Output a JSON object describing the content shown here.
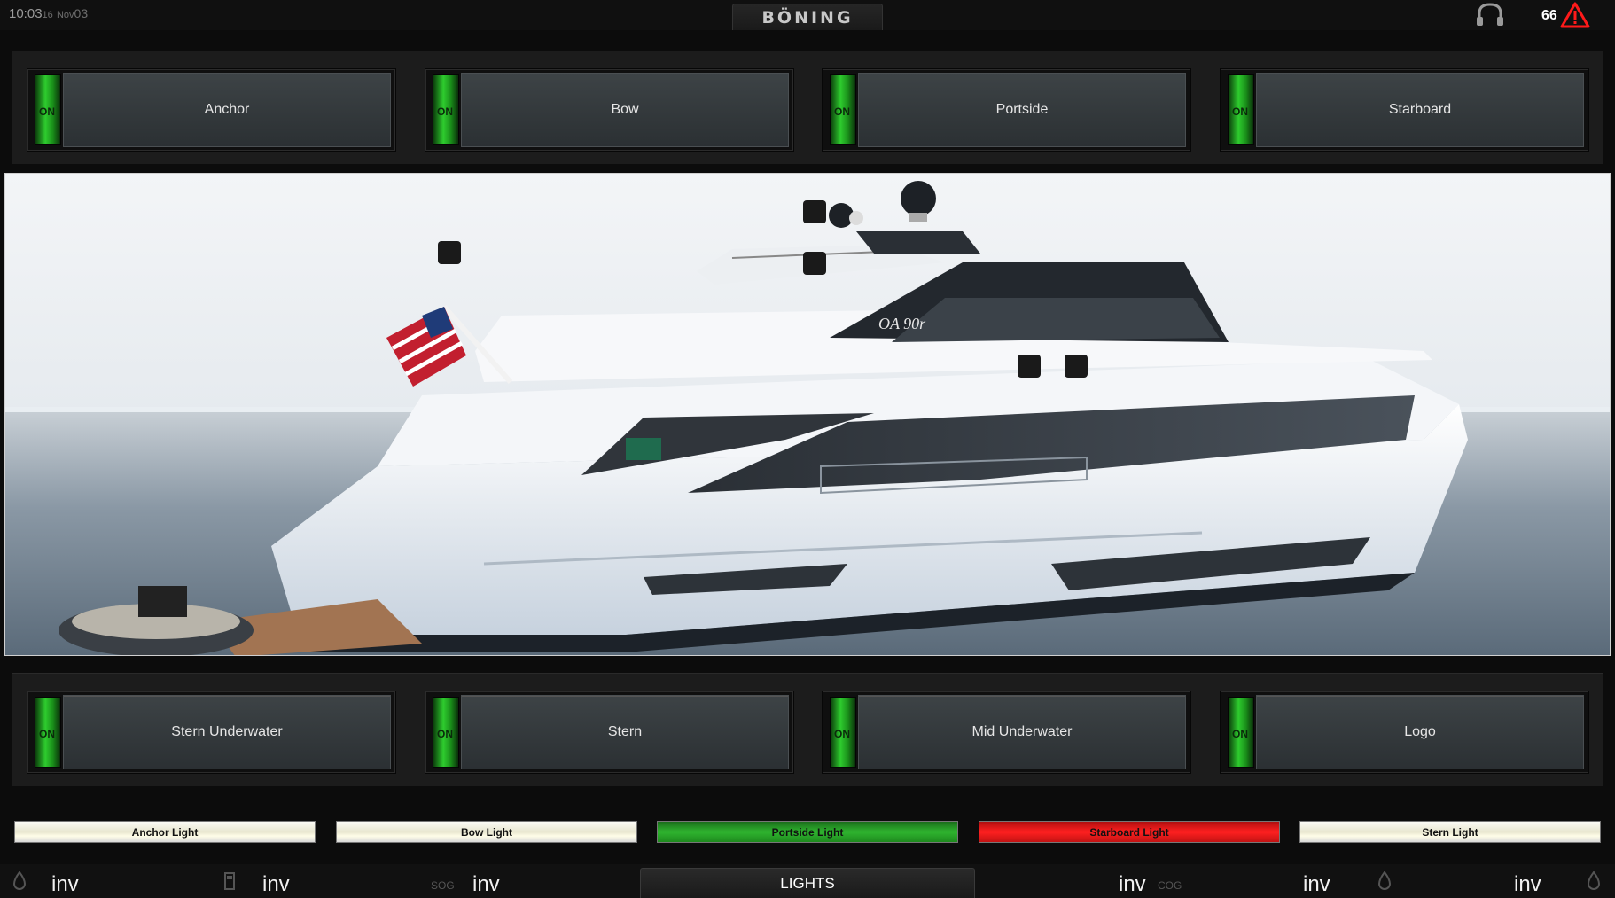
{
  "topbar": {
    "time_hm": "10:03",
    "time_sec": "16",
    "date_month": "Nov",
    "date_day": "03",
    "brand": "BÖNING",
    "alarm_count": "66",
    "icons": [
      "headset-icon",
      "warning-icon"
    ]
  },
  "top_switches": [
    {
      "label": "Anchor",
      "state": "ON"
    },
    {
      "label": "Bow",
      "state": "ON"
    },
    {
      "label": "Portside",
      "state": "ON"
    },
    {
      "label": "Starboard",
      "state": "ON"
    }
  ],
  "bottom_switches": [
    {
      "label": "Stern Underwater",
      "state": "ON"
    },
    {
      "label": "Stern",
      "state": "ON"
    },
    {
      "label": "Mid Underwater",
      "state": "ON"
    },
    {
      "label": "Logo",
      "state": "ON"
    }
  ],
  "yacht": {
    "model_text": "OA 90r"
  },
  "indicators": [
    {
      "label": "Anchor Light",
      "color": "#f5f3dc"
    },
    {
      "label": "Bow Light",
      "color": "#f5f3dc"
    },
    {
      "label": "Portside Light",
      "color": "#2fb42f"
    },
    {
      "label": "Starboard Light",
      "color": "#ff2020"
    },
    {
      "label": "Stern Light",
      "color": "#f5f3dc"
    }
  ],
  "statusbar": {
    "items": [
      {
        "value": "inv",
        "label": "",
        "icon": "fuel-drop-icon"
      },
      {
        "value": "inv",
        "label": "",
        "icon": "fuel-pump-icon"
      },
      {
        "value": "inv",
        "label": "SOG",
        "icon": ""
      },
      {
        "value": "inv",
        "label": "COG",
        "icon": ""
      },
      {
        "value": "inv",
        "label": "",
        "icon": "fuel-drop-icon"
      },
      {
        "value": "inv",
        "label": "",
        "icon": "fuel-drop-icon"
      }
    ],
    "active_tab": "LIGHTS"
  }
}
